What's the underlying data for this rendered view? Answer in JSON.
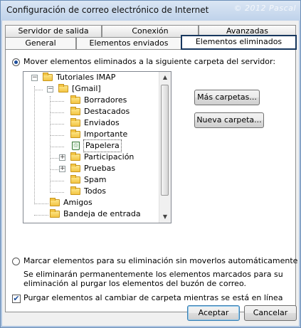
{
  "window": {
    "title": "Configuración de correo electrónico de Internet",
    "watermark": "© 2012 Pascal"
  },
  "tabs": {
    "row_back": [
      {
        "label": "Servidor de salida"
      },
      {
        "label": "Conexión"
      },
      {
        "label": "Avanzadas"
      }
    ],
    "row_front": [
      {
        "label": "General"
      },
      {
        "label": "Elementos enviados"
      },
      {
        "label": "Elementos eliminados",
        "selected": true
      }
    ]
  },
  "options": {
    "move_radio_label": "Mover elementos eliminados a la siguiente carpeta del servidor:",
    "move_radio_checked": true,
    "mark_radio_label": "Marcar elementos para su eliminación sin moverlos automáticamente",
    "mark_radio_checked": false,
    "mark_description_line1": "Se eliminarán permanentemente los elementos marcados para su",
    "mark_description_line2": "eliminación al purgar los elementos del buzón de correo.",
    "purge_checkbox_label": "Purgar elementos al cambiar de carpeta mientras se está en línea",
    "purge_checkbox_checked": true
  },
  "tree": {
    "items": [
      {
        "label": "Tutoriales IMAP",
        "icon": "mailbox-folder-icon",
        "expander": "−"
      },
      {
        "label": "[Gmail]",
        "icon": "folder-icon",
        "expander": "−"
      },
      {
        "label": "Borradores",
        "icon": "folder-icon"
      },
      {
        "label": "Destacados",
        "icon": "folder-icon"
      },
      {
        "label": "Enviados",
        "icon": "folder-icon"
      },
      {
        "label": "Importante",
        "icon": "folder-icon"
      },
      {
        "label": "Papelera",
        "icon": "trash-icon",
        "selected": true
      },
      {
        "label": "Participación",
        "icon": "folder-icon",
        "expander": "+"
      },
      {
        "label": "Pruebas",
        "icon": "folder-icon",
        "expander": "+"
      },
      {
        "label": "Spam",
        "icon": "folder-icon"
      },
      {
        "label": "Todos",
        "icon": "folder-icon"
      },
      {
        "label": "Amigos",
        "icon": "folder-icon"
      },
      {
        "label": "Bandeja de entrada",
        "icon": "inbox-icon"
      }
    ]
  },
  "side_buttons": {
    "more_folders": "Más carpetas...",
    "new_folder": "Nueva carpeta..."
  },
  "footer": {
    "accept": "Aceptar",
    "cancel": "Cancelar"
  },
  "colors": {
    "selected_tab_outline": "#17375e",
    "radio_dot": "#1e4e9a",
    "default_button_border": "#3c7fb1"
  }
}
